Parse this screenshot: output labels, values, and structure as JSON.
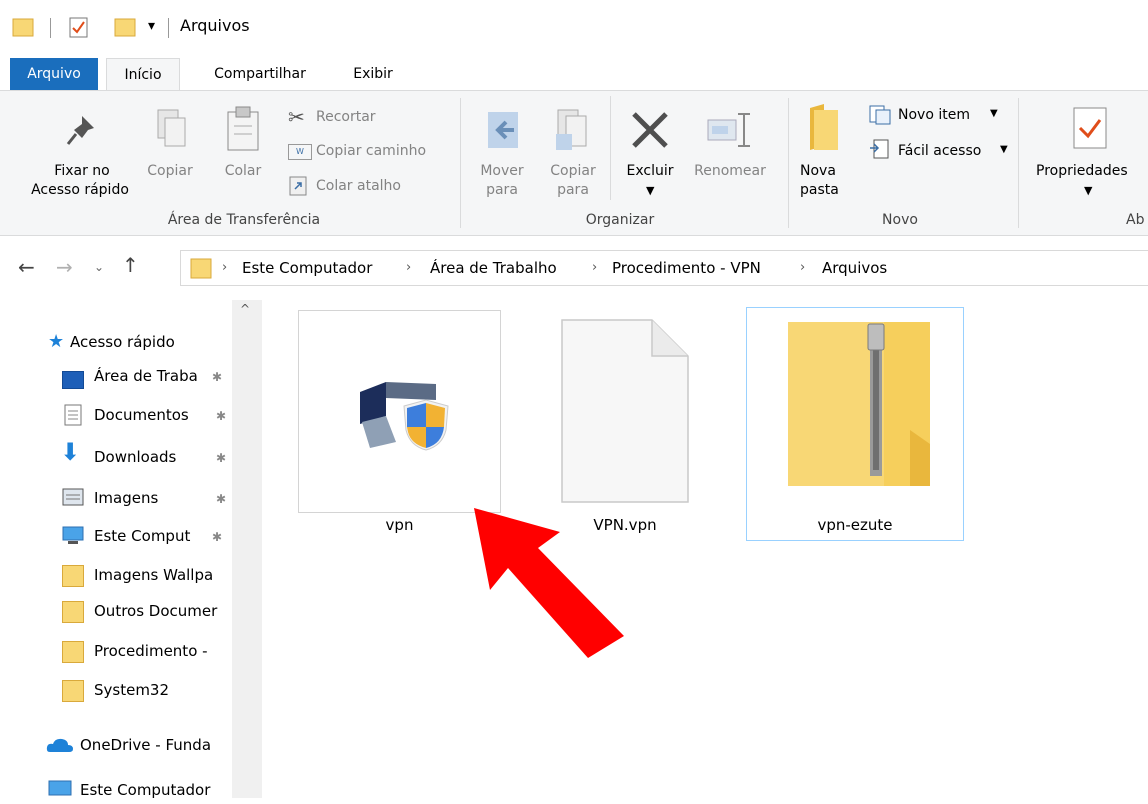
{
  "window": {
    "title": "Arquivos"
  },
  "tabs": [
    {
      "label": "Arquivo"
    },
    {
      "label": "Início"
    },
    {
      "label": "Compartilhar"
    },
    {
      "label": "Exibir"
    }
  ],
  "ribbon": {
    "clipboard": {
      "pin_label_1": "Fixar no",
      "pin_label_2": "Acesso rápido",
      "copy": "Copiar",
      "paste": "Colar",
      "cut": "Recortar",
      "copy_path": "Copiar caminho",
      "paste_shortcut": "Colar atalho",
      "group": "Área de Transferência"
    },
    "organize": {
      "move_1": "Mover",
      "move_2": "para",
      "copy_1": "Copiar",
      "copy_2": "para",
      "delete": "Excluir",
      "rename": "Renomear",
      "group": "Organizar"
    },
    "new": {
      "folder_1": "Nova",
      "folder_2": "pasta",
      "new_item": "Novo item",
      "easy_access": "Fácil acesso",
      "group": "Novo"
    },
    "open": {
      "properties": "Propriedades",
      "group_partial": "Ab"
    }
  },
  "breadcrumb": [
    "Este Computador",
    "Área de Trabalho",
    "Procedimento - VPN",
    "Arquivos"
  ],
  "nav": {
    "quick_access": "Acesso rápido",
    "items": [
      {
        "label": "Área de Traba"
      },
      {
        "label": "Documentos"
      },
      {
        "label": "Downloads"
      },
      {
        "label": "Imagens"
      },
      {
        "label": "Este Comput"
      },
      {
        "label": "Imagens Wallpa"
      },
      {
        "label": "Outros Documer"
      },
      {
        "label": "Procedimento -"
      },
      {
        "label": "System32"
      }
    ],
    "onedrive": "OneDrive - Funda",
    "this_pc": "Este Computador"
  },
  "files": [
    {
      "name": "vpn",
      "icon": "vpn-shield-icon"
    },
    {
      "name": "VPN.vpn",
      "icon": "blank-file-icon"
    },
    {
      "name": "vpn-ezute",
      "icon": "zip-folder-icon"
    }
  ],
  "colors": {
    "accent": "#1a6ebd",
    "arrow": "#ff0000",
    "folder": "#f8d775"
  }
}
